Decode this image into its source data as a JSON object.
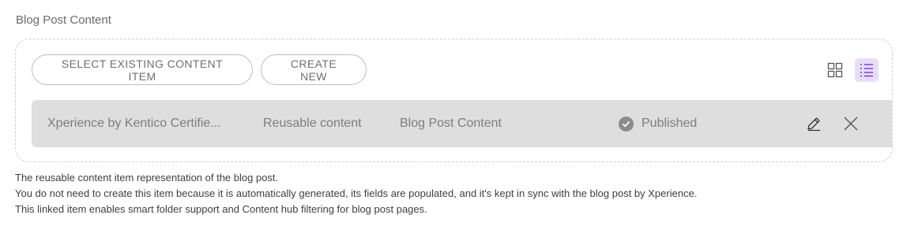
{
  "field": {
    "label": "Blog Post Content"
  },
  "buttons": {
    "select_existing": "SELECT EXISTING CONTENT ITEM",
    "create_new": "CREATE NEW"
  },
  "view_toggle": {
    "grid_icon": "grid-icon",
    "list_icon": "list-icon",
    "active": "list"
  },
  "items": [
    {
      "name": "Xperience by Kentico Certifie...",
      "type": "Reusable content",
      "content_type": "Blog Post Content",
      "status": "Published",
      "status_icon": "check-circle-icon",
      "actions": [
        "edit-icon",
        "close-icon"
      ]
    }
  ],
  "help_text": [
    "The reusable content item representation of the blog post.",
    "You do not need to create this item because it is automatically generated, its fields are populated, and it's kept in sync with the blog post by Xperience.",
    "This linked item enables smart folder support and Content hub filtering for blog post pages."
  ],
  "colors": {
    "active_view_bg": "#e9dcfb",
    "active_view_fg": "#7a3fd1",
    "row_bg": "#dedede"
  }
}
